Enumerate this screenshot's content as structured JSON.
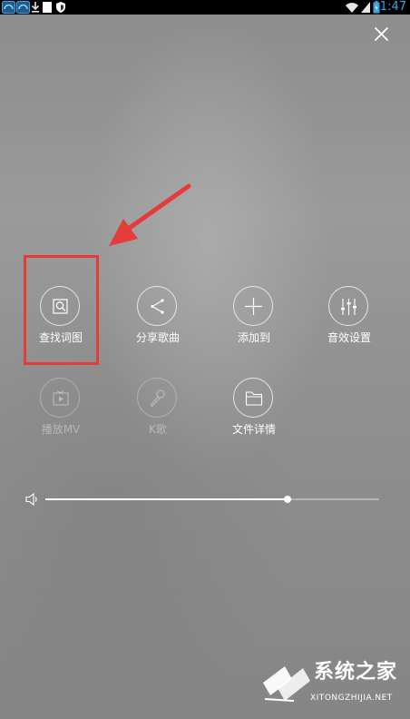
{
  "status_bar": {
    "time": "1:47",
    "icons": [
      "notification-app-icon",
      "notification-app-icon",
      "download-icon",
      "shield-icon",
      "wifi-icon",
      "signal-icon",
      "battery-icon"
    ]
  },
  "close_icon": "close-icon",
  "actions": [
    {
      "label": "查找词图",
      "icon": "search-picture-icon",
      "enabled": true
    },
    {
      "label": "分享歌曲",
      "icon": "share-icon",
      "enabled": true
    },
    {
      "label": "添加到",
      "icon": "add-icon",
      "enabled": true
    },
    {
      "label": "音效设置",
      "icon": "equalizer-icon",
      "enabled": true
    },
    {
      "label": "播放MV",
      "icon": "play-mv-icon",
      "enabled": false
    },
    {
      "label": "K歌",
      "icon": "microphone-icon",
      "enabled": false
    },
    {
      "label": "文件详情",
      "icon": "folder-icon",
      "enabled": true
    }
  ],
  "volume": {
    "icon": "speaker-icon",
    "level": 0.725
  },
  "annotation": {
    "highlight_color": "#e53b3b",
    "arrow_color": "#e53b3b"
  },
  "watermark": {
    "title": "系统之家",
    "url": "XITONGZHIJIA.NET"
  }
}
